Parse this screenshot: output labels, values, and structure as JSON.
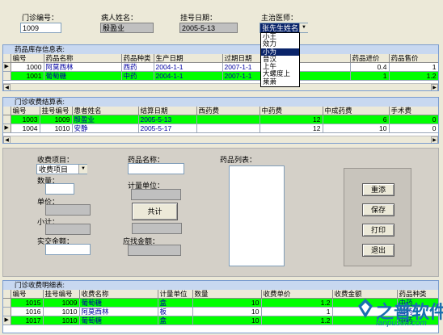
{
  "header": {
    "clinic_no_label": "门诊编号：",
    "clinic_no_value": "1009",
    "patient_label": "病人姓名：",
    "patient_value": "殷盈业",
    "date_label": "挂号日期：",
    "date_value": "2005-5-13",
    "doctor_label": "主治医师：",
    "doctor_value": "张先生姓名",
    "doctor_options": [
      "小王",
      "效力",
      "小为",
      "昔汉",
      "上午",
      "大螺度上",
      "莱萧"
    ],
    "doctor_highlight_index": 2
  },
  "drug_stock": {
    "title": "药品库存信息表:",
    "columns": [
      "编号",
      "药品名称",
      "药品种类",
      "生产日期",
      "过期日期",
      "",
      "药品进价",
      "药品售价"
    ],
    "rows": [
      {
        "marker": "▶",
        "values": [
          "1000",
          "阿莫西林",
          "西药",
          "2004-1-1",
          "2007-1-1",
          "",
          "0.4",
          "1"
        ]
      },
      {
        "marker": "",
        "values": [
          "1001",
          "葡萄糖",
          "中药",
          "2004-1-1",
          "2007-1-1",
          "",
          "1",
          "1.2"
        ]
      }
    ]
  },
  "clinic_fees": {
    "title": "门诊收费结算表:",
    "columns": [
      "编号",
      "挂号编号",
      "患者姓名",
      "结算日期",
      "西药费",
      "中药费",
      "中成药费",
      "手术费"
    ],
    "rows": [
      {
        "marker": "",
        "values": [
          "1003",
          "1009",
          "殷盈业",
          "2005-5-13",
          "",
          "12",
          "6",
          "0"
        ]
      },
      {
        "marker": "▶",
        "values": [
          "1004",
          "1010",
          "安静",
          "2005-5-17",
          "",
          "12",
          "10",
          "0"
        ]
      }
    ]
  },
  "form": {
    "fee_item_label": "收费项目：",
    "fee_item_value": "收费项目",
    "quantity_label": "数量：",
    "unit_price_label": "单价：",
    "subtotal_label": "小计：",
    "paid_label": "实交金额：",
    "drug_name_label": "药品名称：",
    "measure_unit_label": "计量单位：",
    "total_button": "共计",
    "receivable_label": "应找金额：",
    "drug_list_label": "药品列表："
  },
  "buttons": {
    "add": "重添",
    "save": "保存",
    "print": "打印",
    "exit": "退出"
  },
  "fee_details": {
    "title": "门诊收费明细表:",
    "columns": [
      "编号",
      "挂号编号",
      "收费名称",
      "计量单位",
      "数量",
      "收费单价",
      "收费金额",
      "药品种类"
    ],
    "rows": [
      {
        "marker": "",
        "values": [
          "1015",
          "1009",
          "葡萄糖",
          "盒",
          "10",
          "1.2",
          "",
          "中药"
        ]
      },
      {
        "marker": "",
        "values": [
          "1016",
          "1010",
          "阿莫西林",
          "板",
          "10",
          "1",
          "",
          "西药"
        ]
      },
      {
        "marker": "▶",
        "values": [
          "1017",
          "1010",
          "葡萄糖",
          "盒",
          "10",
          "1.2",
          "",
          "中药"
        ]
      }
    ]
  },
  "watermark": {
    "brand": "之普软件",
    "url": "fanpusoft.com"
  }
}
